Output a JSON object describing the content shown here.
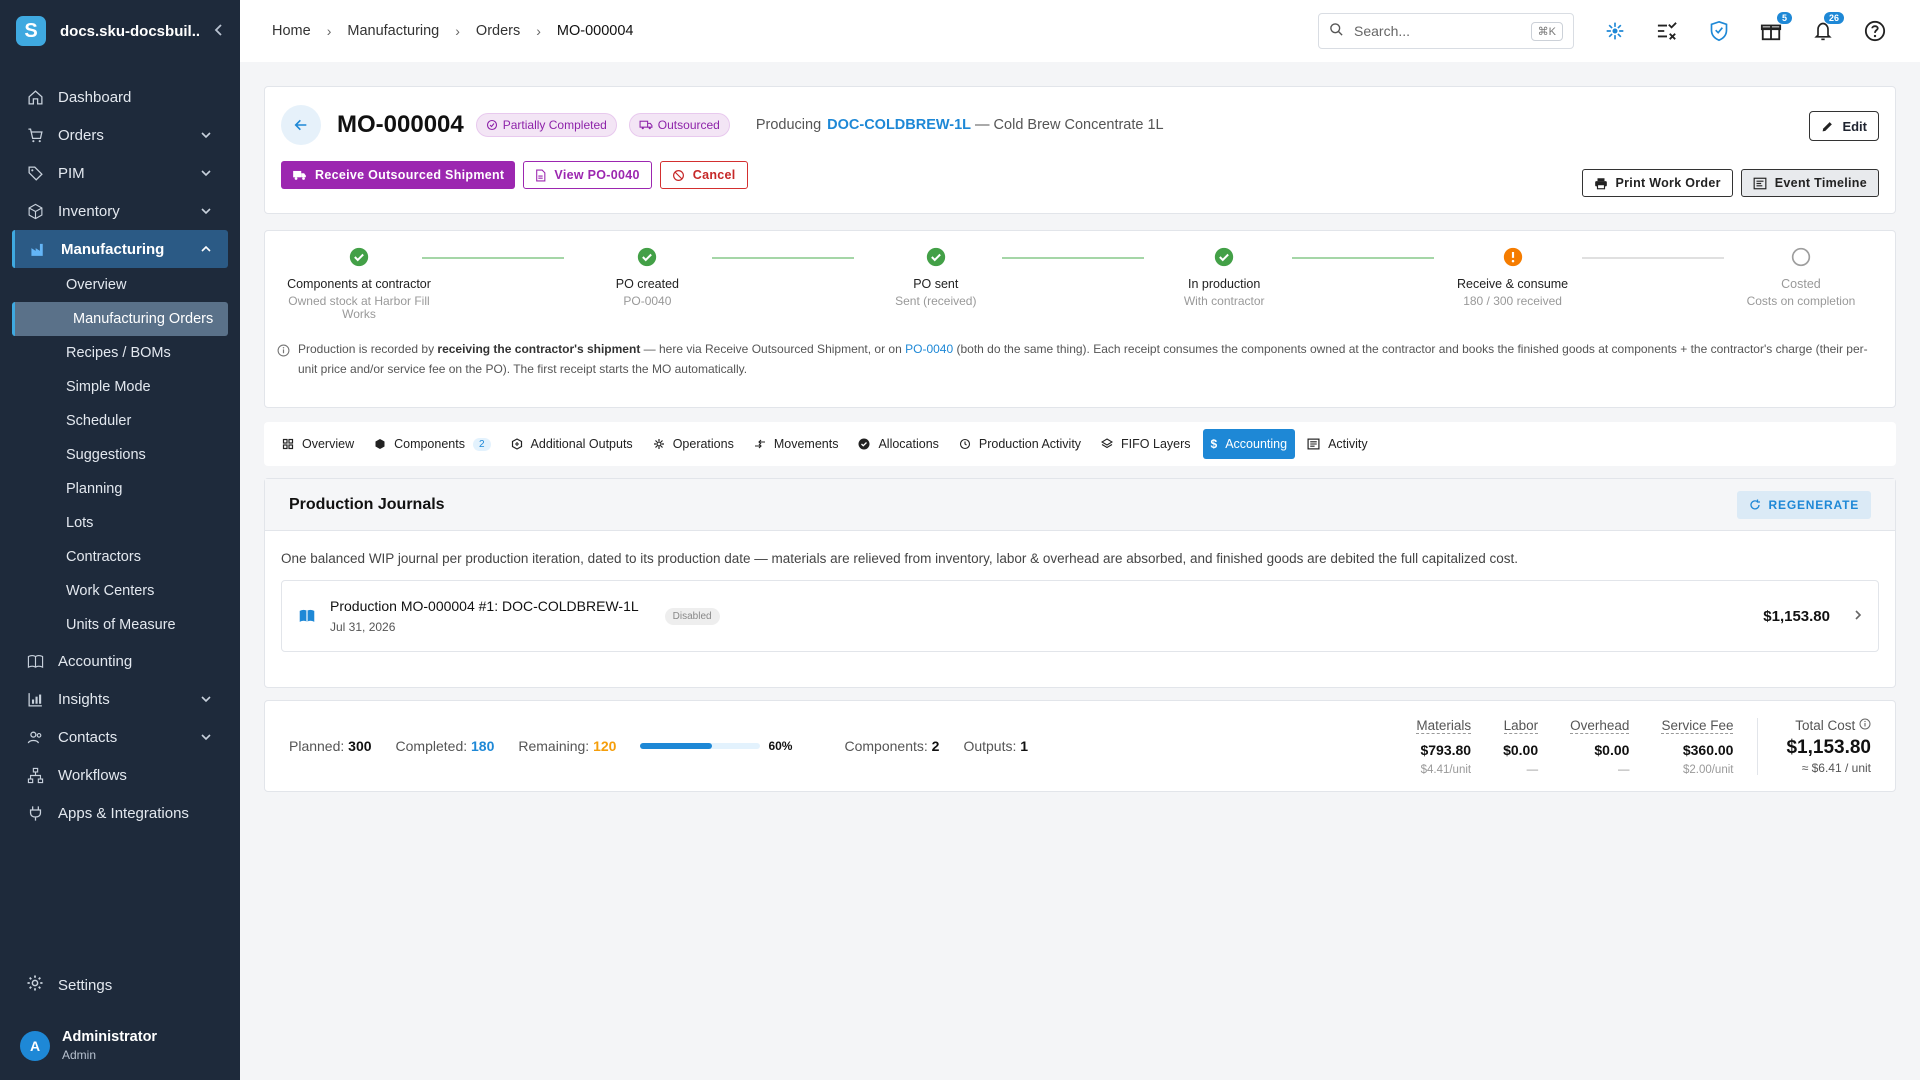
{
  "app": {
    "name": "docs.sku-docsbuil...",
    "logo_letter": "S"
  },
  "sidebar": {
    "items": [
      {
        "label": "Dashboard",
        "icon": "home-icon"
      },
      {
        "label": "Orders",
        "icon": "cart-icon"
      },
      {
        "label": "PIM",
        "icon": "tag-icon"
      },
      {
        "label": "Inventory",
        "icon": "box-icon"
      },
      {
        "label": "Manufacturing",
        "icon": "factory-icon"
      },
      {
        "label": "Accounting",
        "icon": "book-icon"
      },
      {
        "label": "Insights",
        "icon": "bar-chart-icon"
      },
      {
        "label": "Contacts",
        "icon": "people-icon"
      },
      {
        "label": "Workflows",
        "icon": "workflow-icon"
      },
      {
        "label": "Apps & Integrations",
        "icon": "plug-icon"
      }
    ],
    "manufacturing_sub": [
      "Overview",
      "Manufacturing Orders",
      "Recipes / BOMs",
      "Simple Mode",
      "Scheduler",
      "Suggestions",
      "Planning",
      "Lots",
      "Contractors",
      "Work Centers",
      "Units of Measure"
    ],
    "settings": "Settings",
    "user": {
      "name": "Administrator",
      "role": "Admin",
      "initial": "A"
    }
  },
  "topbar": {
    "breadcrumbs": [
      "Home",
      "Manufacturing",
      "Orders",
      "MO-000004"
    ],
    "search_placeholder": "Search...",
    "search_shortcut": "⌘K",
    "gift_badge": "5",
    "bell_badge": "26"
  },
  "header": {
    "mo_number": "MO-000004",
    "status_chip": "Partially Completed",
    "type_chip": "Outsourced",
    "producing_label": "Producing",
    "sku": "DOC-COLDBREW-1L",
    "product_name": "— Cold Brew Concentrate 1L",
    "edit_label": "Edit",
    "receive_label": "Receive Outsourced Shipment",
    "view_po_label": "View PO-0040",
    "cancel_label": "Cancel",
    "print_label": "Print Work Order",
    "timeline_label": "Event Timeline"
  },
  "stepper": {
    "steps": [
      {
        "title": "Components at contractor",
        "sub": "Owned stock at Harbor Fill Works",
        "state": "done"
      },
      {
        "title": "PO created",
        "sub": "PO-0040",
        "state": "done"
      },
      {
        "title": "PO sent",
        "sub": "Sent (received)",
        "state": "done"
      },
      {
        "title": "In production",
        "sub": "With contractor",
        "state": "done"
      },
      {
        "title": "Receive & consume",
        "sub": "180 / 300 received",
        "state": "warning"
      },
      {
        "title": "Costed",
        "sub": "Costs on completion",
        "state": "pending"
      }
    ],
    "info_prefix": "Production is recorded by ",
    "info_bold": "receiving the contractor's shipment",
    "info_mid": " — here via Receive Outsourced Shipment, or on ",
    "info_link": "PO-0040",
    "info_suffix": " (both do the same thing). Each receipt consumes the components owned at the contractor and books the finished goods at components + the contractor's charge (their per-unit price and/or service fee on the PO). The first receipt starts the MO automatically."
  },
  "tabs": [
    {
      "label": "Overview",
      "icon": "grid-icon"
    },
    {
      "label": "Components",
      "icon": "cube-icon",
      "count": "2"
    },
    {
      "label": "Additional Outputs",
      "icon": "cube-plus-icon"
    },
    {
      "label": "Operations",
      "icon": "gear-icon"
    },
    {
      "label": "Movements",
      "icon": "arrows-icon"
    },
    {
      "label": "Allocations",
      "icon": "check-circle-icon"
    },
    {
      "label": "Production Activity",
      "icon": "history-icon"
    },
    {
      "label": "FIFO Layers",
      "icon": "layers-icon"
    },
    {
      "label": "Accounting",
      "icon": "dollar-icon",
      "active": true
    },
    {
      "label": "Activity",
      "icon": "list-icon"
    }
  ],
  "journals": {
    "title": "Production Journals",
    "regenerate_label": "REGENERATE",
    "description": "One balanced WIP journal per production iteration, dated to its production date — materials are relieved from inventory, labor & overhead are absorbed, and finished goods are debited the full capitalized cost.",
    "entries": [
      {
        "name": "Production MO-000004 #1: DOC-COLDBREW-1L",
        "date": "Jul 31, 2026",
        "status": "Disabled",
        "amount": "$1,153.80"
      }
    ]
  },
  "summary": {
    "planned_label": "Planned:",
    "planned": "300",
    "completed_label": "Completed:",
    "completed": "180",
    "remaining_label": "Remaining:",
    "remaining": "120",
    "progress": 0.6,
    "progress_label": "60%",
    "components_label": "Components:",
    "components": "2",
    "outputs_label": "Outputs:",
    "outputs": "1",
    "costs": [
      {
        "label": "Materials",
        "value": "$793.80",
        "unit": "$4.41/unit"
      },
      {
        "label": "Labor",
        "value": "$0.00",
        "unit": "—"
      },
      {
        "label": "Overhead",
        "value": "$0.00",
        "unit": "—"
      },
      {
        "label": "Service Fee",
        "value": "$360.00",
        "unit": "$2.00/unit"
      }
    ],
    "total_label": "Total Cost",
    "total_value": "$1,153.80",
    "total_unit": "≈ $6.41 / unit"
  },
  "colors": {
    "sidebar": "#1e2a3b",
    "accent": "#1e88d6",
    "purple": "#9c27b0",
    "success": "#43a047",
    "warning": "#f57c00"
  }
}
